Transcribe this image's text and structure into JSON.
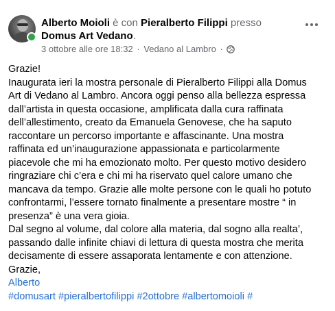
{
  "header": {
    "author": "Alberto Moioli",
    "connector_with": "è con",
    "tagged": "Pieralberto Filippi",
    "connector_at": "presso",
    "place": "Domus Art Vedano",
    "place_suffix": "."
  },
  "meta": {
    "timestamp": "3 ottobre alle ore 18:32",
    "separator": "·",
    "location": "Vedano al Lambro",
    "privacy_icon": "globe-icon"
  },
  "menu": {
    "icon": "more-options-icon"
  },
  "body": {
    "lines": [
      "Grazie!",
      "Inaugurata ieri la mostra personale di Pieralberto Filippi alla Domus",
      "Art di Vedano al Lambro. Ancora oggi penso alla bellezza  espressa",
      "dall’artista in questa occasione, amplificata dalla cura raffinata",
      "dell’allestimento, creato da Emanuela Genovese, che ha saputo",
      "raccontare un percorso importante e affascinante. Una mostra",
      "raffinata ed un’inaugurazione appassionata e particolarmente",
      "piacevole che mi ha emozionato molto. Per questo motivo desidero",
      "ringraziare chi c’era e chi mi ha riservato quel calore umano che",
      "mancava da tempo. Grazie alle molte persone con le quali ho potuto",
      "confrontarmi, l’essere  tornato finalmente a presentare mostre “ in",
      "presenza” è una vera gioia.",
      "Dal segno al volume, dal colore alla materia, dal sogno alla realta’,",
      "passando dalle infinite chiavi di lettura di questa mostra che merita",
      "decisamente di essere assaporata lentamente e con attenzione.",
      "Grazie,"
    ],
    "signature": "Alberto",
    "hashtags": [
      "#domusart",
      "#pieralbertofilippi",
      "#2ottobre",
      "#albertomoioli",
      "#"
    ]
  },
  "colors": {
    "link": "#216fdb",
    "secondary_text": "#65676b",
    "online": "#31a24c"
  }
}
